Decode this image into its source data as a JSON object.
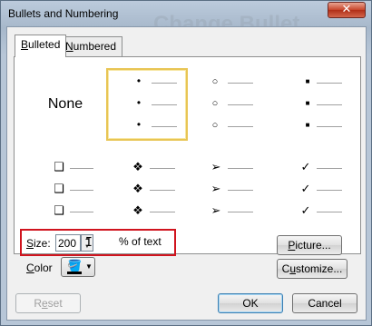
{
  "window": {
    "title": "Bullets and Numbering",
    "close_glyph": "✕",
    "background_heading": "Change Bullet"
  },
  "tabs": [
    {
      "label_prefix": "",
      "label_underlined": "B",
      "label_rest": "ulleted",
      "active": true
    },
    {
      "label_prefix": "",
      "label_underlined": "N",
      "label_rest": "umbered",
      "active": false
    }
  ],
  "bullets": {
    "none_label": "None",
    "styles": [
      {
        "id": "none",
        "glyph": ""
      },
      {
        "id": "small-dot",
        "glyph": "•"
      },
      {
        "id": "hollow-circle",
        "glyph": "○"
      },
      {
        "id": "filled-square",
        "glyph": "■"
      },
      {
        "id": "hollow-square",
        "glyph": "❑"
      },
      {
        "id": "four-diamonds",
        "glyph": "❖"
      },
      {
        "id": "arrowhead",
        "glyph": "➢"
      },
      {
        "id": "checkmark",
        "glyph": "✓"
      }
    ],
    "selected": "small-dot"
  },
  "size": {
    "label_underlined": "S",
    "label_rest": "ize:",
    "value": "200",
    "suffix": "% of text"
  },
  "color": {
    "label_prefix": "",
    "label_underlined": "C",
    "label_rest": "olor",
    "swatch": "#000000"
  },
  "buttons": {
    "picture_underlined": "P",
    "picture_rest": "icture...",
    "customize_prefix": "C",
    "customize_underlined": "u",
    "customize_rest": "stomize...",
    "reset_prefix": "R",
    "reset_underlined": "e",
    "reset_rest": "set",
    "ok": "OK",
    "cancel": "Cancel"
  },
  "colors": {
    "selection_border": "#e8c554",
    "highlight_box": "#d0141e",
    "close_button": "#c7442a"
  }
}
